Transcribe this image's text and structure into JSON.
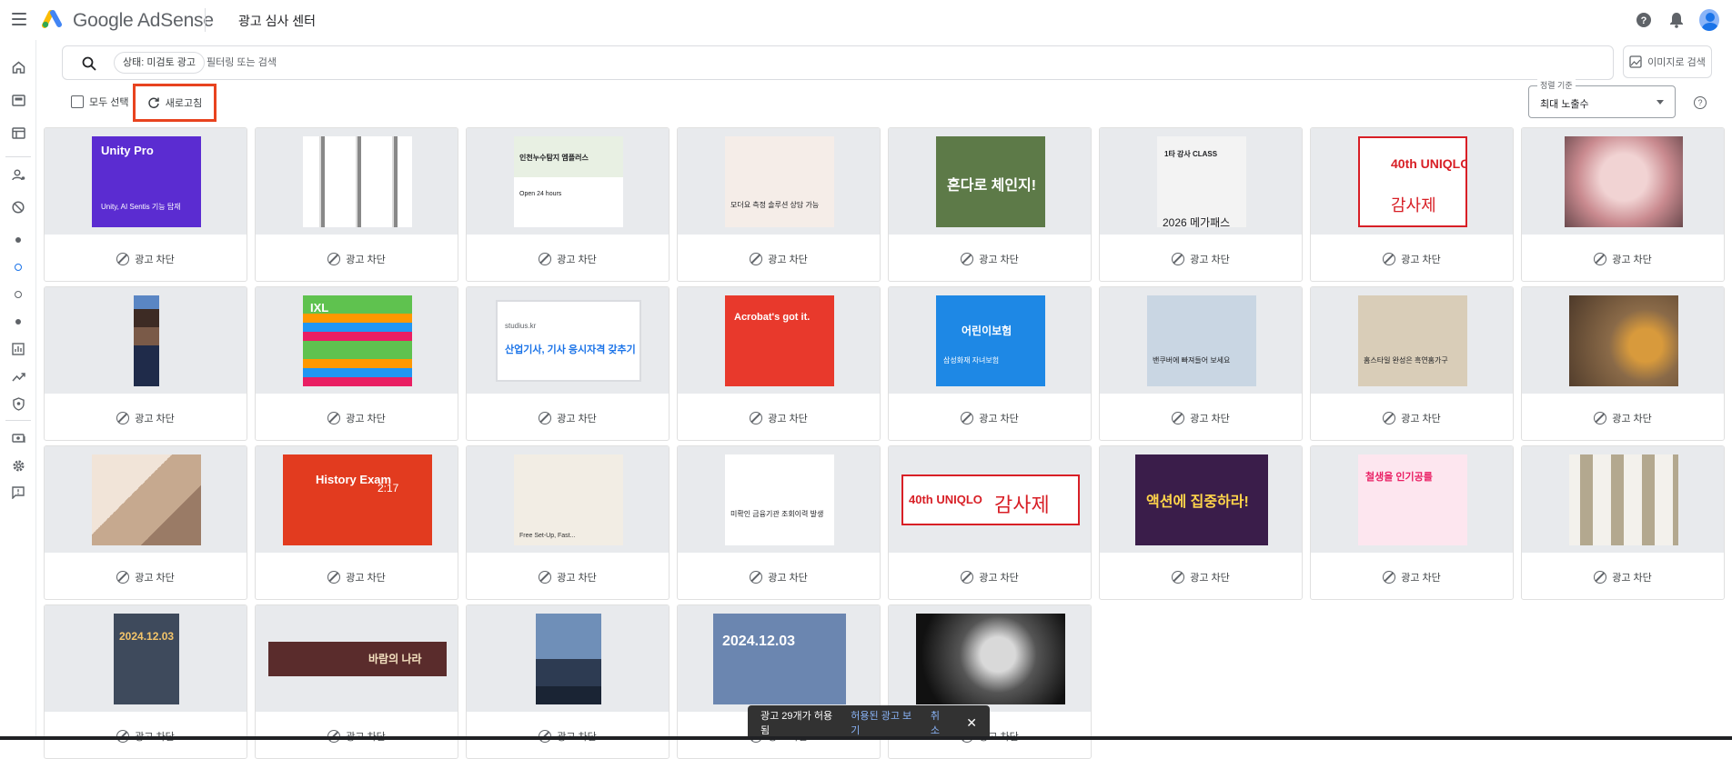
{
  "topbar": {
    "brand": "Google AdSense",
    "page_title": "광고 심사 센터",
    "icons": [
      "menu-icon",
      "help-icon",
      "notifications-icon",
      "avatar"
    ]
  },
  "rail": {
    "icons": [
      "home-icon",
      "ads-icon",
      "sites-icon",
      "account-icon",
      "blocking-icon",
      "dot-icon",
      "ring-icon",
      "ring-icon",
      "dot-icon",
      "reports-icon",
      "trends-icon",
      "policy-icon",
      "payments-icon",
      "settings-icon",
      "feedback-icon"
    ]
  },
  "search": {
    "chip": "상태: 미검토 광고",
    "placeholder": "필터링 또는 검색",
    "image_search_label": "이미지로 검색"
  },
  "toolbar": {
    "select_all": "모두 선택",
    "refresh": "새로고침",
    "sort_label": "정렬 기준",
    "sort_value": "최대 노출수"
  },
  "cards": {
    "block_label": "광고 차단",
    "items": [
      {
        "title": "Unity Pro",
        "line": "Unity, AI Sentis 기능 탑재"
      },
      {
        "title": "",
        "line": ""
      },
      {
        "title": "인천누수탐지 엠플러스",
        "line": "Open 24 hours"
      },
      {
        "title": "",
        "line": "모더요 측정 솔루션 상담 가능"
      },
      {
        "title": "혼다로 체인지!",
        "line": ""
      },
      {
        "title": "1타 강사 CLASS",
        "line": "2026 메가패스"
      },
      {
        "title": "40th UNIQLO",
        "line": "감사제"
      },
      {
        "title": "",
        "line": ""
      },
      {
        "title": "",
        "line": ""
      },
      {
        "title": "IXL",
        "line": ""
      },
      {
        "title": "산업기사, 기사 응시자격 갖추기",
        "line": "studius.kr"
      },
      {
        "title": "Acrobat's got it.",
        "line": ""
      },
      {
        "title": "어린이보험",
        "line": "삼성화재 자녀보험"
      },
      {
        "title": "",
        "line": "밴쿠버에 빠져들어 보세요"
      },
      {
        "title": "",
        "line": "홈스타일 완성은 흑연홈가구"
      },
      {
        "title": "",
        "line": ""
      },
      {
        "title": "",
        "line": ""
      },
      {
        "title": "History Exam",
        "line": "2:17"
      },
      {
        "title": "",
        "line": "Free Set-Up, Fast..."
      },
      {
        "title": "",
        "line": "미확인 금융기관 조회이력 발생"
      },
      {
        "title": "40th UNIQLO",
        "line": "감사제"
      },
      {
        "title": "액션에 집중하라!",
        "line": ""
      },
      {
        "title": "철생을 인기공를",
        "line": ""
      },
      {
        "title": "",
        "line": ""
      },
      {
        "title": "2024.12.03",
        "line": ""
      },
      {
        "title": "바람의 나라",
        "line": ""
      },
      {
        "title": "",
        "line": ""
      },
      {
        "title": "2024.12.03",
        "line": ""
      },
      {
        "title": "",
        "line": ""
      }
    ]
  },
  "snackbar": {
    "message": "광고 29개가 허용됨",
    "view_link": "허용된 광고 보기",
    "undo_link": "취소"
  },
  "colors": {
    "accent": "#1a73e8",
    "highlight_border": "#e8431f",
    "card_media_bg": "#e8eaed"
  }
}
